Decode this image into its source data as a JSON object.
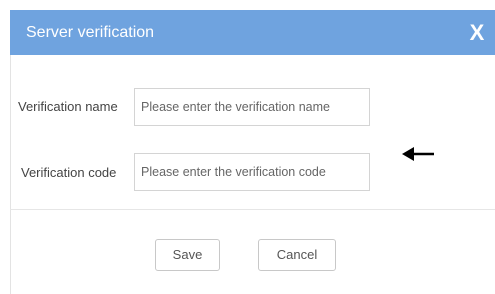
{
  "dialog": {
    "title": "Server verification",
    "close_label": "X"
  },
  "form": {
    "name_label": "Verification name",
    "name_value": "",
    "name_placeholder": "Please enter the verification name",
    "code_label": "Verification code",
    "code_value": "",
    "code_placeholder": "Please enter the verification code"
  },
  "buttons": {
    "save_label": "Save",
    "cancel_label": "Cancel"
  },
  "colors": {
    "title_bar": "#6fa3df",
    "title_text": "#ffffff"
  },
  "icons": {
    "close": "close-icon",
    "pointer": "arrow-left-icon"
  }
}
